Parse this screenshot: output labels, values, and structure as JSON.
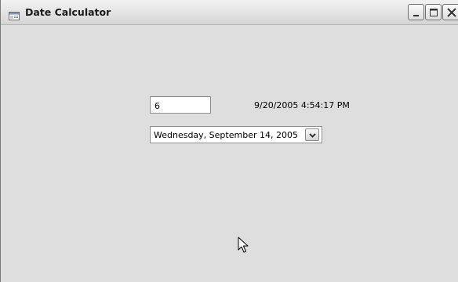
{
  "window": {
    "title": "Date Calculator"
  },
  "icons": {
    "app": "app-window-icon",
    "minimize": "minimize-icon",
    "maximize": "maximize-icon",
    "close": "close-icon",
    "dropdown": "chevron-down-icon",
    "cursor": "mouse-pointer-icon"
  },
  "form": {
    "days_input": {
      "value": "6"
    },
    "result_label": "9/20/2005 4:54:17 PM",
    "date_picker": {
      "value": "Wednesday, September 14, 2005"
    }
  },
  "colors": {
    "window_background": "#dedede",
    "titlebar_text": "#1a1a1a"
  }
}
